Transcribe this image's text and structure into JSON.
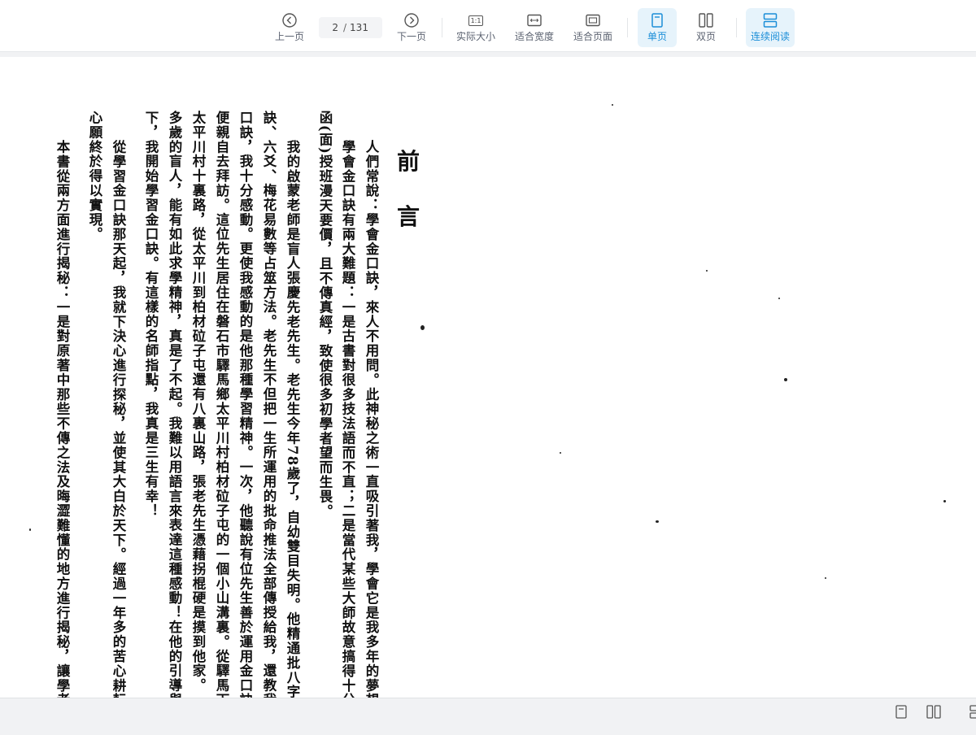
{
  "toolbar": {
    "prev_label": "上一页",
    "next_label": "下一页",
    "current_page": "2",
    "page_separator": "/",
    "total_pages": "131",
    "actual_size_label": "实际大小",
    "actual_size_icon_text": "1:1",
    "fit_width_label": "适合宽度",
    "fit_page_label": "适合页面",
    "single_page_label": "单页",
    "double_page_label": "双页",
    "continuous_label": "连续阅读",
    "accent_color": "#1b8ed8"
  },
  "document": {
    "title_chars": [
      "前",
      "言"
    ],
    "columns": [
      "人們常說：學會金口訣，來人不用問。此神秘之術一直吸引著我，學會它是我多年的夢想。",
      "學會金口訣有兩大難題：一是古書對很多技法語而不直；二是當代某些大師故意搞得十分神秘，",
      "函(面)授班漫天要價，且不傳真經，致使很多初學者望而生畏。",
      "我的啟蒙老師是盲人張慶先老先生。老先生今年78歲了，自幼雙目失明。他精通批八字、金口",
      "訣、六爻、梅花易數等占筮方法。老先生不但把一生所運用的批命推法全部傳授給我，還教我學習金",
      "口訣，我十分感動。更使我感動的是他那種學習精神。一次，他聽說有位先生善於運用金口訣占卜，",
      "便親自去拜訪。這位先生居住在磐石市驛馬鄉太平川村柏材砬子屯的一個小山溝裏。從驛馬下汽車到",
      "太平川村十裏路，從太平川到柏材砬子屯還有八裏山路，張老先生憑藉拐棍硬是摸到他家。一位七十",
      "多歲的盲人，能有如此求學精神，真是了不起。我難以用語言來表達這種感動！在他的引導與鼓舞",
      "下，我開始學習金口訣。有這樣的名師指點，我真是三生有幸！",
      "從學習金口訣那天起，我就下決心進行探秘，並使其大白於天下。經過一年多的苦心耕耘，我的",
      "心願終於得以實現。",
      "本書從兩方面進行揭秘：一是對原著中那些不傳之法及晦澀難懂的地方進行揭秘，讓學者一看便"
    ]
  },
  "statusbar": {
    "icons": [
      "single-page-view-icon",
      "double-page-view-icon",
      "continuous-view-icon"
    ]
  }
}
